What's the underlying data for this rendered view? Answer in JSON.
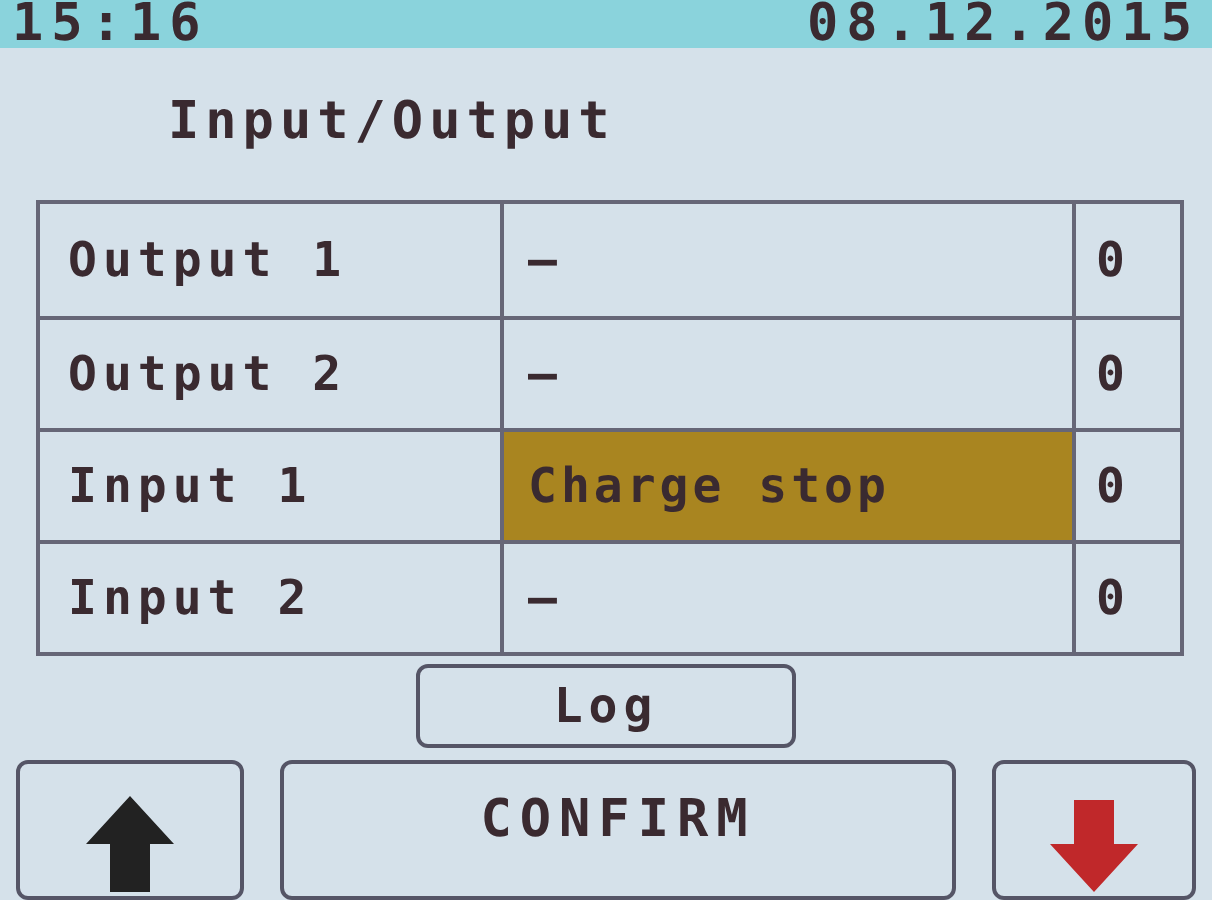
{
  "status_bar": {
    "time": "15:16",
    "date": "08.12.2015"
  },
  "title": "Input/Output",
  "rows": [
    {
      "label": "Output 1",
      "value": "–",
      "count": "0",
      "selected": false
    },
    {
      "label": "Output 2",
      "value": "–",
      "count": "0",
      "selected": false
    },
    {
      "label": "Input 1",
      "value": "Charge stop",
      "count": "0",
      "selected": true
    },
    {
      "label": "Input 2",
      "value": "–",
      "count": "0",
      "selected": false
    }
  ],
  "log_button": "Log",
  "confirm_button": "CONFIRM"
}
